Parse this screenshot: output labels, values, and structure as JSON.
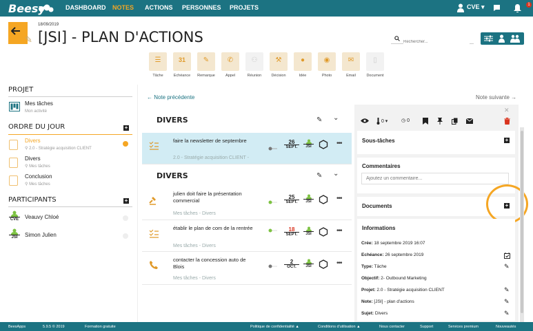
{
  "brand": {
    "logo": "Beesy"
  },
  "nav": {
    "items": [
      "DASHBOARD",
      "NOTES",
      "ACTIONS",
      "PERSONNES",
      "PROJETS"
    ],
    "active": "NOTES"
  },
  "user": {
    "initials": "CVE",
    "notifications": "1"
  },
  "header": {
    "date": "18/09/2019",
    "title": "[JSI] - PLAN D'ACTIONS",
    "search_placeholder": "Rechercher..."
  },
  "toolbar": {
    "items": [
      {
        "label": "Tâche",
        "icon": "task-icon"
      },
      {
        "label": "Echéance",
        "icon": "calendar-icon",
        "glyph": "31"
      },
      {
        "label": "Remarque",
        "icon": "pencil-icon"
      },
      {
        "label": "Appel",
        "icon": "phone-icon"
      },
      {
        "label": "Réunion",
        "icon": "meeting-icon"
      },
      {
        "label": "Décision",
        "icon": "gavel-icon"
      },
      {
        "label": "Idée",
        "icon": "bulb-icon"
      },
      {
        "label": "Photo",
        "icon": "camera-icon"
      },
      {
        "label": "Email",
        "icon": "email-icon"
      },
      {
        "label": "Document",
        "icon": "document-icon"
      }
    ]
  },
  "left": {
    "projet_title": "PROJET",
    "projet_item": {
      "label": "Mes tâches",
      "sub": "Mon activité"
    },
    "ordre_title": "ORDRE DU JOUR",
    "ordre_items": [
      {
        "label": "Divers",
        "sub": "2.0 - Stratégie acquisition CLIENT",
        "active": true
      },
      {
        "label": "Divers",
        "sub": "Mes tâches"
      },
      {
        "label": "Conclusion",
        "sub": "Mes tâches"
      }
    ],
    "participants_title": "PARTICIPANTS",
    "participants": [
      {
        "initials": "CVE",
        "name": "Veauvy Chloé"
      },
      {
        "initials": "JSI",
        "name": "Simon Julien"
      }
    ]
  },
  "notes_nav": {
    "prev": "← Note précédente",
    "next": "Note suivante →"
  },
  "groups": [
    {
      "title": "DIVERS",
      "cards": [
        {
          "text": "faire la newsletter de septembre",
          "sub": "2.0 - Stratégie acquisition CLIENT -",
          "day": "26",
          "month": "SEPT.",
          "owner": "JSI",
          "selected": true
        }
      ]
    },
    {
      "title": "DIVERS",
      "cards": [
        {
          "text": "julien doit faire la présentation commercial",
          "sub": "Mes tâches - Divers",
          "day": "25",
          "month": "SEPT.",
          "owner": "JSI"
        },
        {
          "text": "établir le plan de com de la rentrée",
          "sub": "Mes tâches - Divers",
          "day": "18",
          "month": "SEPT.",
          "owner": "JSI",
          "overdue": true
        },
        {
          "text": "contacter la concession auto de Blois",
          "sub": "Mes tâches - Divers",
          "day": "2",
          "month": "OCT.",
          "owner": "JSI"
        }
      ]
    }
  ],
  "detail": {
    "toolbar_values": {
      "thermo": "0",
      "clock": "0"
    },
    "soustaches": "Sous-tâches",
    "commentaires": "Commentaires",
    "comment_placeholder": "Ajoutez un commentaire...",
    "documents": "Documents",
    "informations": "Informations",
    "info": [
      {
        "k": "Crée:",
        "v": " 18 septembre 2019 16:07"
      },
      {
        "k": "Echéance:",
        "v": " 26 septembre 2019"
      },
      {
        "k": "Type:",
        "v": " Tâche"
      },
      {
        "k": "Objectif:",
        "v": " 2- Outbound Marketing"
      },
      {
        "k": "Projet:",
        "v": " 2.0 - Stratégie acquisition CLIENT"
      },
      {
        "k": "Note:",
        "v": " [JSI] - plan d'actions"
      },
      {
        "k": "Sujet:",
        "v": " Divers"
      }
    ]
  },
  "footer": {
    "items": [
      "BeesApps",
      "5.9.5 © 2019",
      "Formation gratuite",
      "Politique de confidentialité ▲",
      "Conditions d'utilisation ▲",
      "Nous contacter",
      "Support",
      "Services premium",
      "Nouveautés"
    ]
  },
  "colors": {
    "teal": "#1c7382",
    "orange": "#f5a623",
    "red": "#d9341f"
  }
}
